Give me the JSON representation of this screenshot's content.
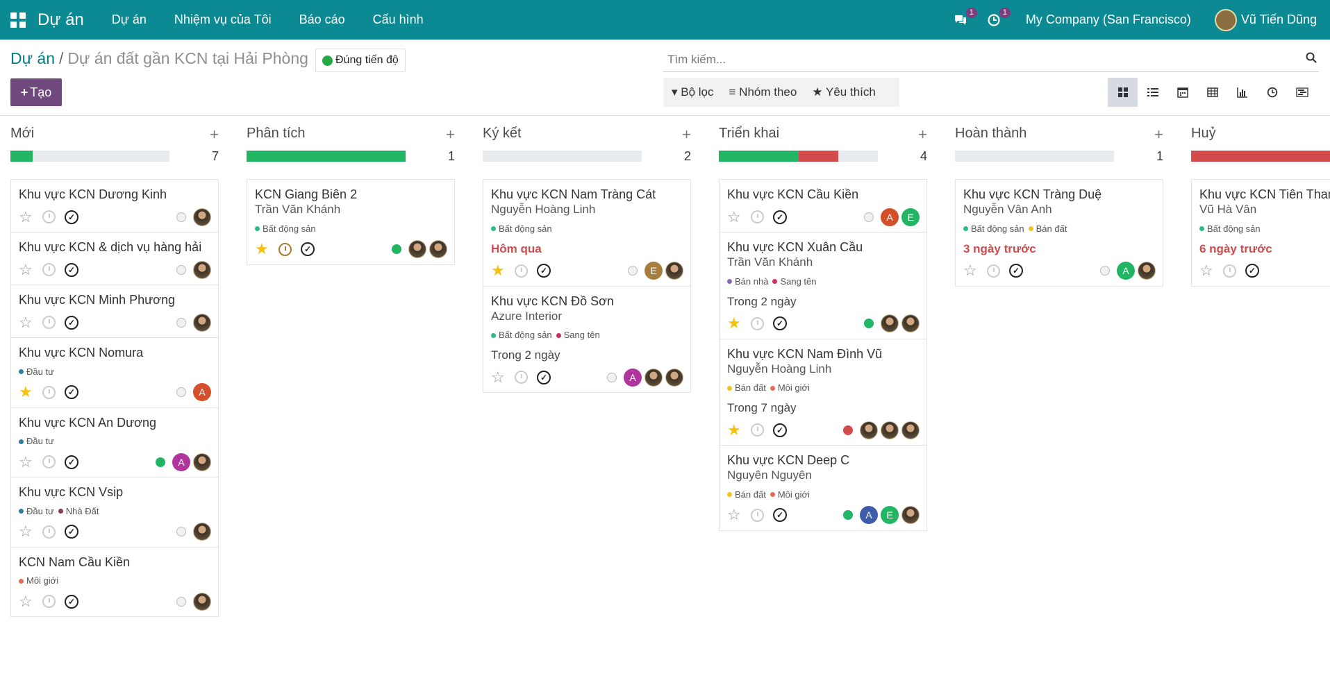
{
  "navbar": {
    "app_name": "Dự án",
    "menu": [
      "Dự án",
      "Nhiệm vụ của Tôi",
      "Báo cáo",
      "Cấu hình"
    ],
    "messages_badge": "1",
    "activities_badge": "1",
    "company": "My Company (San Francisco)",
    "user": "Vũ Tiến Dũng"
  },
  "breadcrumb": {
    "root": "Dự án",
    "separator": "/",
    "current": "Dự án đất gần KCN tại Hải Phòng"
  },
  "status_label": "Đúng tiến độ",
  "create_label": "Tạo",
  "search": {
    "placeholder": "Tìm kiếm..."
  },
  "filters": {
    "filter": "Bộ lọc",
    "group_by": "Nhóm theo",
    "favorites": "Yêu thích"
  },
  "view_icons": [
    "kanban-icon",
    "list-icon",
    "calendar-icon",
    "pivot-icon",
    "graph-icon",
    "activity-icon",
    "gantt-icon"
  ],
  "colors": {
    "navbar": "#0b8a94",
    "primary": "#71487d",
    "success": "#21b564",
    "danger": "#d24b4d",
    "late": "#d24b4d"
  },
  "columns": [
    {
      "name": "Mới",
      "count": "7",
      "progress": [
        {
          "color": "#21b564",
          "pct": 14
        }
      ],
      "cards": [
        {
          "title": "Khu vực KCN Dương Kinh",
          "subtitle": "",
          "tags": [],
          "deadline": "",
          "deadline_late": false,
          "starred": false,
          "clock_active": false,
          "kstate": "normal",
          "avatars": [
            {
              "type": "photo",
              "letter": "",
              "color": ""
            }
          ]
        },
        {
          "title": "Khu vực KCN & dịch vụ hàng hải",
          "subtitle": "",
          "tags": [],
          "deadline": "",
          "deadline_late": false,
          "starred": false,
          "clock_active": false,
          "kstate": "normal",
          "avatars": [
            {
              "type": "photo",
              "letter": "",
              "color": ""
            }
          ]
        },
        {
          "title": "Khu vực KCN Minh Phương",
          "subtitle": "",
          "tags": [],
          "deadline": "",
          "deadline_late": false,
          "starred": false,
          "clock_active": false,
          "kstate": "normal",
          "avatars": [
            {
              "type": "photo",
              "letter": "",
              "color": ""
            }
          ]
        },
        {
          "title": "Khu vực KCN Nomura",
          "subtitle": "",
          "tags": [
            {
              "label": "Đầu tư",
              "color": "#2e7fa0"
            }
          ],
          "deadline": "",
          "deadline_late": false,
          "starred": true,
          "clock_active": false,
          "kstate": "normal",
          "avatars": [
            {
              "type": "letter",
              "letter": "A",
              "color": "#d4502a"
            }
          ]
        },
        {
          "title": "Khu vực KCN An Dương",
          "subtitle": "",
          "tags": [
            {
              "label": "Đầu tư",
              "color": "#2e7fa0"
            }
          ],
          "deadline": "",
          "deadline_late": false,
          "starred": false,
          "clock_active": false,
          "kstate": "green",
          "avatars": [
            {
              "type": "letter",
              "letter": "A",
              "color": "#b0359c"
            },
            {
              "type": "photo",
              "letter": "",
              "color": ""
            }
          ]
        },
        {
          "title": "Khu vực KCN Vsip",
          "subtitle": "",
          "tags": [
            {
              "label": "Đầu tư",
              "color": "#2e7fa0"
            },
            {
              "label": "Nhà Đất",
              "color": "#8b3a52"
            }
          ],
          "deadline": "",
          "deadline_late": false,
          "starred": false,
          "clock_active": false,
          "kstate": "normal",
          "avatars": [
            {
              "type": "photo",
              "letter": "",
              "color": ""
            }
          ]
        },
        {
          "title": "KCN Nam Cầu Kiền",
          "subtitle": "",
          "tags": [
            {
              "label": "Môi giới",
              "color": "#e46b53"
            }
          ],
          "deadline": "",
          "deadline_late": false,
          "starred": false,
          "clock_active": false,
          "kstate": "normal",
          "avatars": [
            {
              "type": "photo",
              "letter": "",
              "color": ""
            }
          ]
        }
      ]
    },
    {
      "name": "Phân tích",
      "count": "1",
      "progress": [
        {
          "color": "#21b564",
          "pct": 100
        }
      ],
      "cards": [
        {
          "title": "KCN Giang Biên 2",
          "subtitle": "Trần Văn Khánh",
          "tags": [
            {
              "label": "Bất động sản",
              "color": "#2ab88e"
            }
          ],
          "deadline": "",
          "deadline_late": false,
          "starred": true,
          "clock_active": true,
          "kstate": "green",
          "avatars": [
            {
              "type": "photo",
              "letter": "",
              "color": ""
            },
            {
              "type": "photo",
              "letter": "",
              "color": ""
            }
          ]
        }
      ]
    },
    {
      "name": "Ký kết",
      "count": "2",
      "progress": [],
      "cards": [
        {
          "title": "Khu vực KCN Nam Tràng Cát",
          "subtitle": "Nguyễn Hoàng Linh",
          "tags": [
            {
              "label": "Bất động sản",
              "color": "#2ab88e"
            }
          ],
          "deadline": "Hôm qua",
          "deadline_late": true,
          "starred": true,
          "clock_active": false,
          "kstate": "normal",
          "avatars": [
            {
              "type": "letter",
              "letter": "E",
              "color": "#a67e3f"
            },
            {
              "type": "photo",
              "letter": "",
              "color": ""
            }
          ]
        },
        {
          "title": "Khu vực KCN Đồ Sơn",
          "subtitle": "Azure Interior",
          "tags": [
            {
              "label": "Bất động sản",
              "color": "#2ab88e"
            },
            {
              "label": "Sang tên",
              "color": "#c8305e"
            }
          ],
          "deadline": "Trong 2 ngày",
          "deadline_late": false,
          "starred": false,
          "clock_active": false,
          "kstate": "normal",
          "avatars": [
            {
              "type": "letter",
              "letter": "A",
              "color": "#b0359c"
            },
            {
              "type": "photo",
              "letter": "",
              "color": ""
            },
            {
              "type": "photo",
              "letter": "",
              "color": ""
            }
          ]
        }
      ]
    },
    {
      "name": "Triển khai",
      "count": "4",
      "progress": [
        {
          "color": "#21b564",
          "pct": 50
        },
        {
          "color": "#d24b4d",
          "pct": 25
        }
      ],
      "cards": [
        {
          "title": "Khu vực KCN Cầu Kiền",
          "subtitle": "",
          "tags": [],
          "deadline": "",
          "deadline_late": false,
          "starred": false,
          "clock_active": false,
          "kstate": "normal",
          "avatars": [
            {
              "type": "letter",
              "letter": "A",
              "color": "#d4502a"
            },
            {
              "type": "letter",
              "letter": "E",
              "color": "#21b564"
            }
          ]
        },
        {
          "title": "Khu vực KCN Xuân Cầu",
          "subtitle": "Trần Văn Khánh",
          "tags": [
            {
              "label": "Bán nhà",
              "color": "#8a63b3"
            },
            {
              "label": "Sang tên",
              "color": "#c8305e"
            }
          ],
          "deadline": "Trong 2 ngày",
          "deadline_late": false,
          "starred": true,
          "clock_active": false,
          "kstate": "green",
          "avatars": [
            {
              "type": "photo",
              "letter": "",
              "color": ""
            },
            {
              "type": "photo",
              "letter": "",
              "color": ""
            }
          ]
        },
        {
          "title": "Khu vực KCN Nam Đình Vũ",
          "subtitle": "Nguyễn Hoàng Linh",
          "tags": [
            {
              "label": "Bán đất",
              "color": "#f0c419"
            },
            {
              "label": "Môi giới",
              "color": "#e46b53"
            }
          ],
          "deadline": "Trong 7 ngày",
          "deadline_late": false,
          "starred": true,
          "clock_active": false,
          "kstate": "red",
          "avatars": [
            {
              "type": "photo",
              "letter": "",
              "color": ""
            },
            {
              "type": "photo",
              "letter": "",
              "color": ""
            },
            {
              "type": "photo",
              "letter": "",
              "color": ""
            }
          ]
        },
        {
          "title": "Khu vực KCN Deep C",
          "subtitle": "Nguyên Nguyên",
          "tags": [
            {
              "label": "Bán đất",
              "color": "#f0c419"
            },
            {
              "label": "Môi giới",
              "color": "#e46b53"
            }
          ],
          "deadline": "",
          "deadline_late": false,
          "starred": false,
          "clock_active": false,
          "kstate": "green",
          "avatars": [
            {
              "type": "letter",
              "letter": "A",
              "color": "#3d5ba9"
            },
            {
              "type": "letter",
              "letter": "E",
              "color": "#21b564"
            },
            {
              "type": "photo",
              "letter": "",
              "color": ""
            }
          ]
        }
      ]
    },
    {
      "name": "Hoàn thành",
      "count": "1",
      "progress": [],
      "cards": [
        {
          "title": "Khu vực KCN Tràng Duệ",
          "subtitle": "Nguyễn Vân Anh",
          "tags": [
            {
              "label": "Bất động sản",
              "color": "#2ab88e"
            },
            {
              "label": "Bán đất",
              "color": "#f0c419"
            }
          ],
          "deadline": "3 ngày trước",
          "deadline_late": true,
          "starred": false,
          "clock_active": false,
          "kstate": "normal",
          "avatars": [
            {
              "type": "letter",
              "letter": "A",
              "color": "#21b564"
            },
            {
              "type": "photo",
              "letter": "",
              "color": ""
            }
          ]
        }
      ]
    },
    {
      "name": "Huỷ",
      "count": "",
      "progress": [
        {
          "color": "#d24b4d",
          "pct": 100
        }
      ],
      "cards": [
        {
          "title": "Khu vực KCN Tiên Thanh",
          "subtitle": "Vũ Hà Vân",
          "tags": [
            {
              "label": "Bất động sản",
              "color": "#2ab88e"
            }
          ],
          "deadline": "6 ngày trước",
          "deadline_late": true,
          "starred": false,
          "clock_active": false,
          "kstate": "red",
          "avatars": []
        }
      ]
    }
  ]
}
